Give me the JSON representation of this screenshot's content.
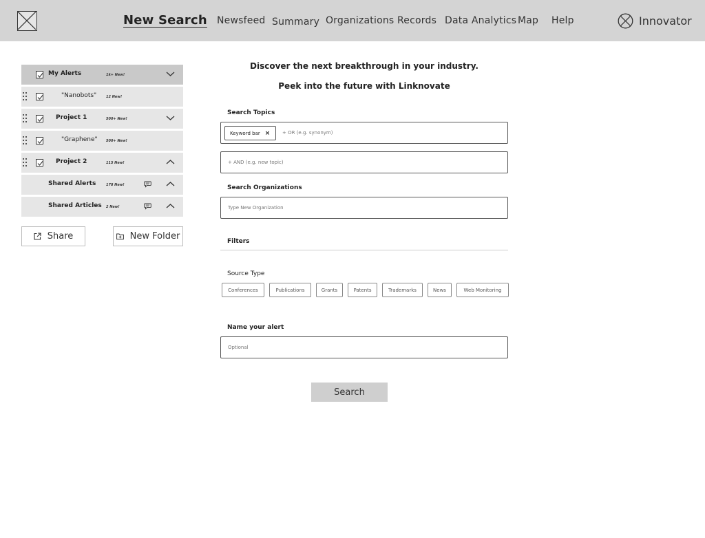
{
  "nav": {
    "active": "New Search",
    "items": [
      "Newsfeed",
      "Summary",
      "Organizations",
      "Records",
      "Data Analytics",
      "Map",
      "Help"
    ],
    "user_name": "Innovator"
  },
  "sidebar": {
    "rows": [
      {
        "label": "My Alerts",
        "count": "1k+ New!"
      },
      {
        "label": "\"Nanobots\"",
        "count": "12 New!"
      },
      {
        "label": "Project 1",
        "count": "500+ New!"
      },
      {
        "label": "\"Graphene\"",
        "count": "500+ New!"
      },
      {
        "label": "Project 2",
        "count": "115 New!"
      },
      {
        "label": "Shared Alerts",
        "count": "178 New!"
      },
      {
        "label": "Shared Articles",
        "count": "2 New!"
      }
    ],
    "share_label": "Share",
    "new_folder_label": "New Folder"
  },
  "main": {
    "headline1": "Discover the next breakthrough in your industry.",
    "headline2": "Peek into the future with Linknovate",
    "topics_label": "Search Topics",
    "chip_label": "Keyword bar",
    "chip_remove": "×",
    "or_placeholder": "+ OR (e.g. synonym)",
    "and_placeholder": "+ AND (e.g. new topic)",
    "orgs_label": "Search Organizations",
    "orgs_placeholder": "Type New Organization",
    "filters_label": "Filters",
    "source_type_label": "Source Type",
    "source_types": [
      "Conferences",
      "Publications",
      "Grants",
      "Patents",
      "Trademarks",
      "News",
      "Web Monitoring"
    ],
    "alert_name_label": "Name your alert",
    "alert_name_placeholder": "Optional",
    "search_label": "Search"
  }
}
